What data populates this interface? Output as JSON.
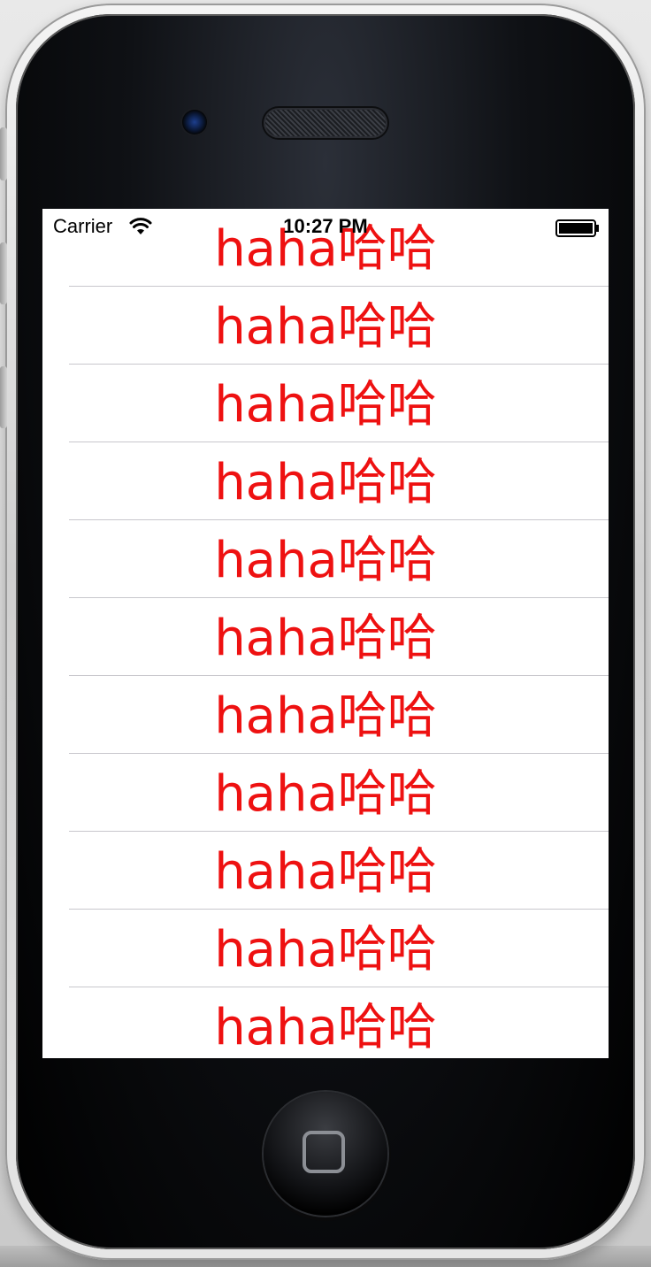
{
  "status_bar": {
    "carrier": "Carrier",
    "time": "10:27 PM",
    "icons": [
      "wifi-icon",
      "battery-icon"
    ]
  },
  "table": {
    "rows": [
      {
        "label": "haha哈哈"
      },
      {
        "label": "haha哈哈"
      },
      {
        "label": "haha哈哈"
      },
      {
        "label": "haha哈哈"
      },
      {
        "label": "haha哈哈"
      },
      {
        "label": "haha哈哈"
      },
      {
        "label": "haha哈哈"
      },
      {
        "label": "haha哈哈"
      },
      {
        "label": "haha哈哈"
      },
      {
        "label": "haha哈哈"
      },
      {
        "label": "haha哈哈"
      }
    ]
  },
  "colors": {
    "row_text": "#ee1111",
    "separator": "#c8c7cc",
    "screen_bg": "#ffffff"
  }
}
